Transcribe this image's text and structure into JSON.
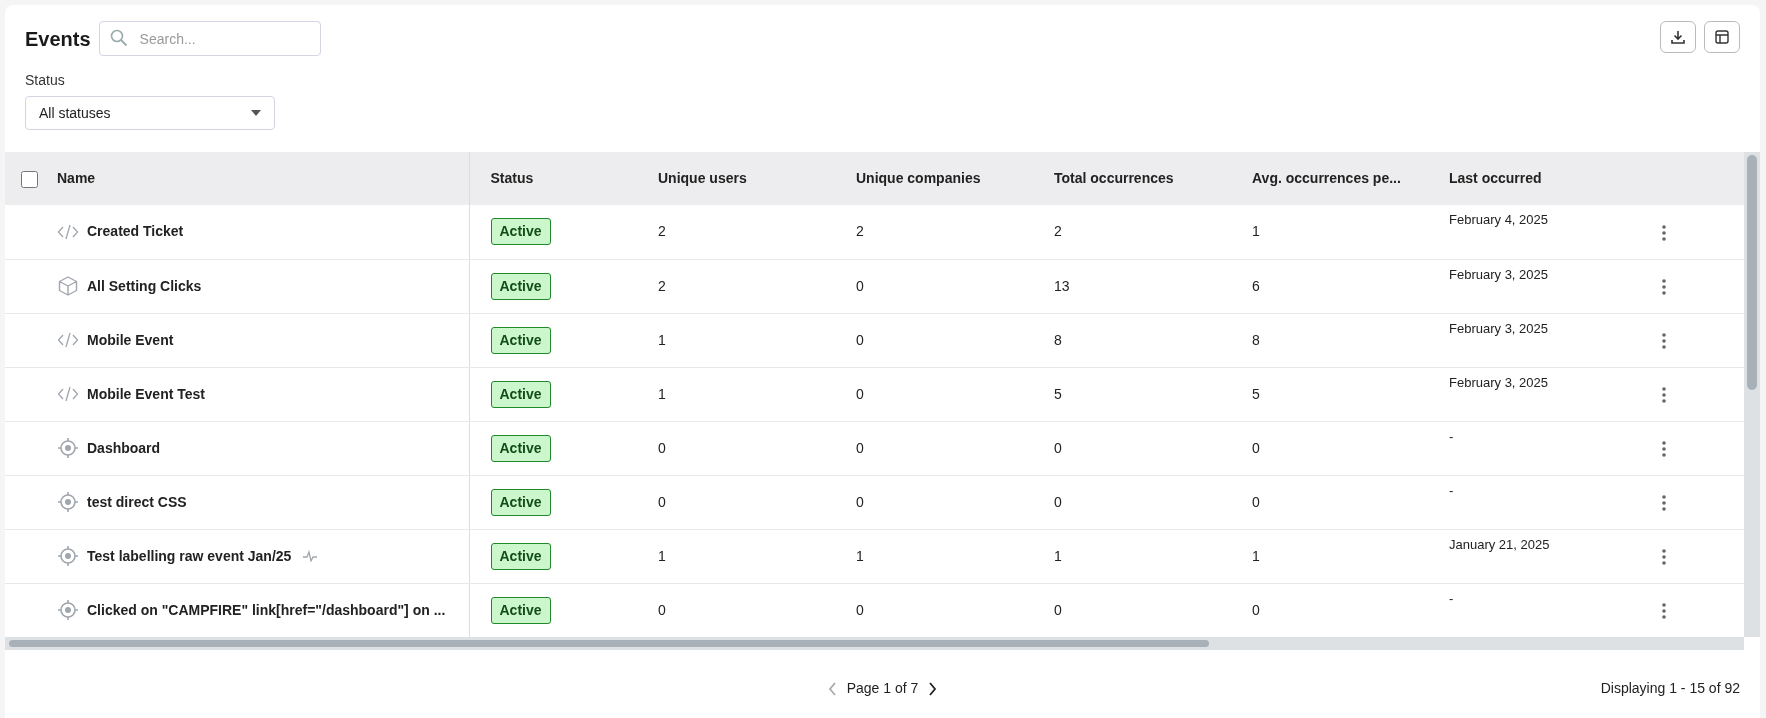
{
  "title": "Events",
  "search": {
    "placeholder": "Search..."
  },
  "status_filter": {
    "label": "Status",
    "value": "All statuses"
  },
  "table": {
    "select_all": {
      "checked": false
    },
    "columns": [
      "Name",
      "Status",
      "Unique users",
      "Unique companies",
      "Total occurrences",
      "Avg. occurrences pe...",
      "Last occurred"
    ],
    "rows": [
      {
        "kind": "code",
        "name": "Created Ticket",
        "raw": false,
        "status": "Active",
        "unique_users": "2",
        "unique_companies": "2",
        "total_occurrences": "2",
        "avg_occurrences": "1",
        "last_occurred": "February 4, 2025"
      },
      {
        "kind": "cube",
        "name": "All Setting Clicks",
        "raw": false,
        "status": "Active",
        "unique_users": "2",
        "unique_companies": "0",
        "total_occurrences": "13",
        "avg_occurrences": "6",
        "last_occurred": "February 3, 2025"
      },
      {
        "kind": "code",
        "name": "Mobile Event",
        "raw": false,
        "status": "Active",
        "unique_users": "1",
        "unique_companies": "0",
        "total_occurrences": "8",
        "avg_occurrences": "8",
        "last_occurred": "February 3, 2025"
      },
      {
        "kind": "code",
        "name": "Mobile Event Test",
        "raw": false,
        "status": "Active",
        "unique_users": "1",
        "unique_companies": "0",
        "total_occurrences": "5",
        "avg_occurrences": "5",
        "last_occurred": "February 3, 2025"
      },
      {
        "kind": "target",
        "name": "Dashboard",
        "raw": false,
        "status": "Active",
        "unique_users": "0",
        "unique_companies": "0",
        "total_occurrences": "0",
        "avg_occurrences": "0",
        "last_occurred": "-"
      },
      {
        "kind": "target",
        "name": "test direct CSS",
        "raw": false,
        "status": "Active",
        "unique_users": "0",
        "unique_companies": "0",
        "total_occurrences": "0",
        "avg_occurrences": "0",
        "last_occurred": "-"
      },
      {
        "kind": "target",
        "name": "Test labelling raw event Jan/25",
        "raw": true,
        "status": "Active",
        "unique_users": "1",
        "unique_companies": "1",
        "total_occurrences": "1",
        "avg_occurrences": "1",
        "last_occurred": "January 21, 2025"
      },
      {
        "kind": "target",
        "name": "Clicked on \"CAMPFIRE\" link[href=\"/dashboard\"] on ...",
        "raw": false,
        "status": "Active",
        "unique_users": "0",
        "unique_companies": "0",
        "total_occurrences": "0",
        "avg_occurrences": "0",
        "last_occurred": "-"
      }
    ]
  },
  "pagination": {
    "prev": {
      "disabled": true
    },
    "label": "Page 1 of 7",
    "next": {
      "disabled": false
    }
  },
  "summary": "Displaying 1 - 15 of 92"
}
